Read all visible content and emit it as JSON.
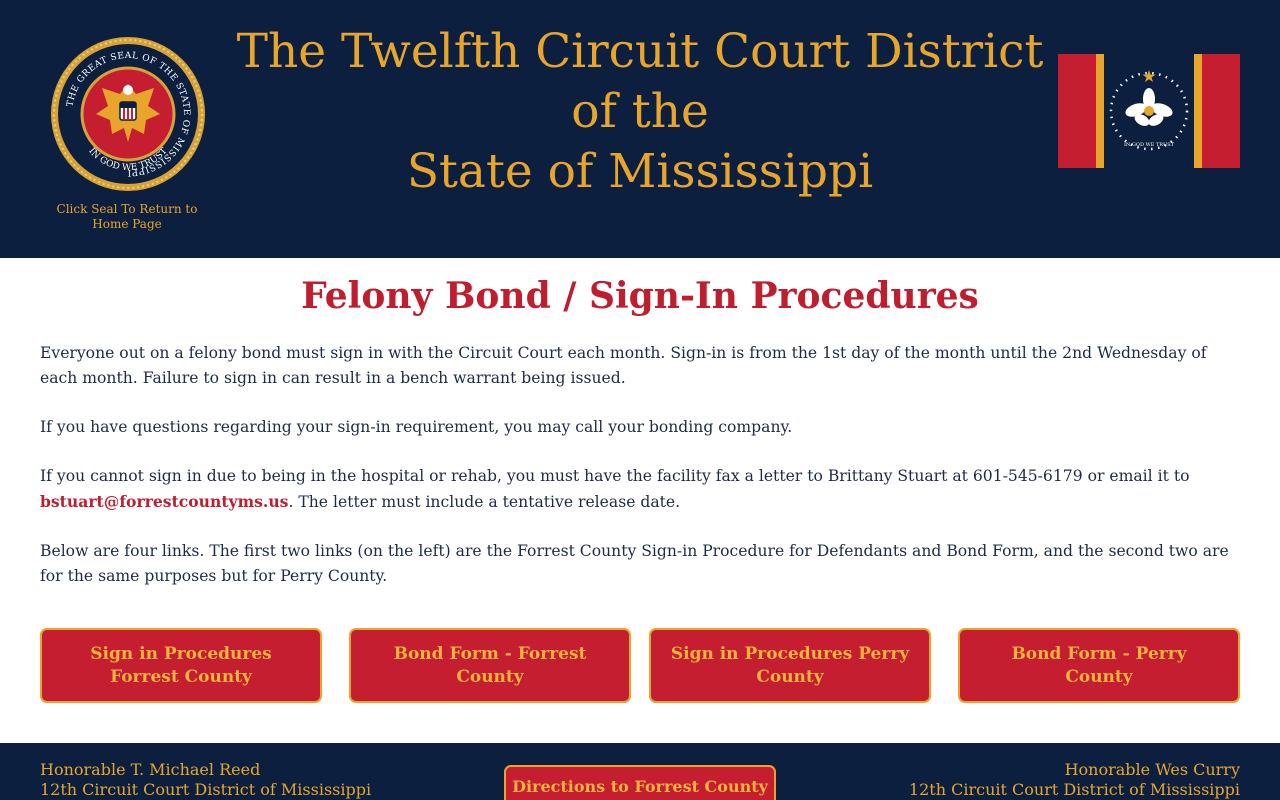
{
  "header": {
    "seal_caption": "Click Seal To Return to Home Page",
    "seal_text": {
      "ring": "THE GREAT SEAL OF THE STATE OF MISSISSIPPI",
      "motto": "IN GOD WE TRUST"
    },
    "flag_motto": "IN GOD WE TRUST",
    "title_lines": [
      "The Twelfth Circuit Court District",
      "of the",
      "State of Mississippi"
    ]
  },
  "page": {
    "heading": "Felony Bond / Sign-In Procedures",
    "paragraphs": [
      "Everyone out on a felony bond must sign in with the Circuit Court each month. Sign-in is from the 1st day of the month until the 2nd Wednesday of each month. Failure to sign in can result in a bench warrant being issued.",
      "If you have questions regarding your sign-in requirement, you may call your bonding company.",
      "If you cannot sign in due to being in the hospital or rehab, you must have the facility fax a letter to Brittany Stuart at 601-545-6179 or email it to",
      "Below are four links. The first two links (on the left) are the Forrest County Sign-in Procedure for Defendants and Bond Form, and the second two are for the same purposes but for Perry County."
    ],
    "email": "bstuart@forrestcountyms.us",
    "email_suffix": ".   The letter must include a tentative release date."
  },
  "buttons": [
    "Sign in Procedures Forrest County",
    "Bond Form - Forrest County",
    "Sign in Procedures Perry County",
    "Bond Form - Perry County"
  ],
  "footer": {
    "left_name": "Honorable T. Michael Reed",
    "left_title": "12th Circuit Court District of Mississippi",
    "center_button": "Directions to Forrest County",
    "right_name": "Honorable Wes Curry",
    "right_title": "12th Circuit Court District of Mississippi"
  },
  "colors": {
    "navy": "#0c1f3f",
    "gold": "#e8a52c",
    "red": "#c41e30",
    "heading_red": "#bf1e2e",
    "text": "#1f2a44"
  },
  "icons": [
    "state-seal-icon",
    "mississippi-flag-icon"
  ]
}
